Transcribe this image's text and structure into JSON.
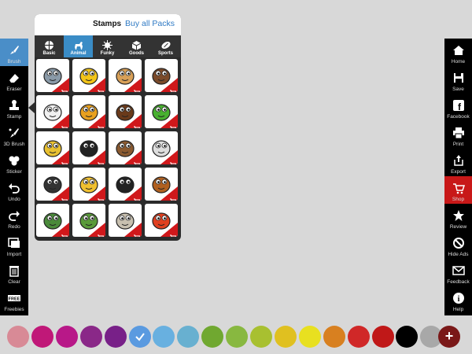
{
  "left_tools": [
    {
      "label": "Brush",
      "icon": "brush-icon",
      "active": true
    },
    {
      "label": "Eraser",
      "icon": "eraser-icon"
    },
    {
      "label": "Stamp",
      "icon": "stamp-icon"
    },
    {
      "label": "3D Brush",
      "icon": "3d-brush-icon"
    },
    {
      "label": "Sticker",
      "icon": "sticker-icon"
    },
    {
      "label": "Undo",
      "icon": "undo-icon"
    },
    {
      "label": "Redo",
      "icon": "redo-icon"
    },
    {
      "label": "Import",
      "icon": "import-icon"
    },
    {
      "label": "Clear",
      "icon": "trash-icon"
    },
    {
      "label": "Freebies",
      "icon": "free-icon"
    }
  ],
  "right_tools": [
    {
      "label": "Home",
      "icon": "home-icon"
    },
    {
      "label": "Save",
      "icon": "save-icon"
    },
    {
      "label": "Facebook",
      "icon": "facebook-icon"
    },
    {
      "label": "Print",
      "icon": "print-icon"
    },
    {
      "label": "Export",
      "icon": "export-icon"
    },
    {
      "label": "Shop",
      "icon": "cart-icon",
      "highlight": "#c81818"
    },
    {
      "label": "Review",
      "icon": "star-icon"
    },
    {
      "label": "Hide Ads",
      "icon": "no-ads-icon"
    },
    {
      "label": "Feedback",
      "icon": "mail-icon"
    },
    {
      "label": "Help",
      "icon": "help-icon"
    }
  ],
  "stamps_panel": {
    "title": "Stamps",
    "buy_all": "Buy all Packs",
    "tabs": [
      {
        "label": "Basic",
        "icon": "ball-icon"
      },
      {
        "label": "Animal",
        "icon": "dog-icon",
        "active": true
      },
      {
        "label": "Funky",
        "icon": "splat-icon"
      },
      {
        "label": "Goods",
        "icon": "box-icon"
      },
      {
        "label": "Sports",
        "icon": "football-icon"
      }
    ],
    "stamps": [
      {
        "name": "elephant",
        "color": "#8a9aa8"
      },
      {
        "name": "bee",
        "color": "#f2c418"
      },
      {
        "name": "cat",
        "color": "#d8a058"
      },
      {
        "name": "bear",
        "color": "#7a4a2a"
      },
      {
        "name": "cow",
        "color": "#f0f0f0"
      },
      {
        "name": "parrot",
        "color": "#e8a020"
      },
      {
        "name": "moose",
        "color": "#6a3a1a"
      },
      {
        "name": "frog",
        "color": "#48b030"
      },
      {
        "name": "leopard",
        "color": "#e8c030"
      },
      {
        "name": "penguin",
        "color": "#222222"
      },
      {
        "name": "beaver",
        "color": "#8a5a30"
      },
      {
        "name": "zebra",
        "color": "#dddddd"
      },
      {
        "name": "scorpion",
        "color": "#333333"
      },
      {
        "name": "giraffe",
        "color": "#f0c030"
      },
      {
        "name": "puffin",
        "color": "#222222"
      },
      {
        "name": "monkey",
        "color": "#b06020"
      },
      {
        "name": "dinosaur",
        "color": "#4a8a3a"
      },
      {
        "name": "triceratops",
        "color": "#5a9a3a"
      },
      {
        "name": "wolf",
        "color": "#c8c0b0"
      },
      {
        "name": "rooster",
        "color": "#e04020"
      }
    ]
  },
  "palette": {
    "colors": [
      "#d88a96",
      "#c01878",
      "#b81888",
      "#8a2888",
      "#782088",
      "#5a9ae0",
      "#68b0e0",
      "#68b0d0",
      "#70a830",
      "#88b840",
      "#a8c030",
      "#e0c020",
      "#e8e020",
      "#d88020",
      "#d02828",
      "#c01818",
      "#000000",
      "#a8a8a8"
    ],
    "selected_index": 5,
    "add_label": "+"
  }
}
